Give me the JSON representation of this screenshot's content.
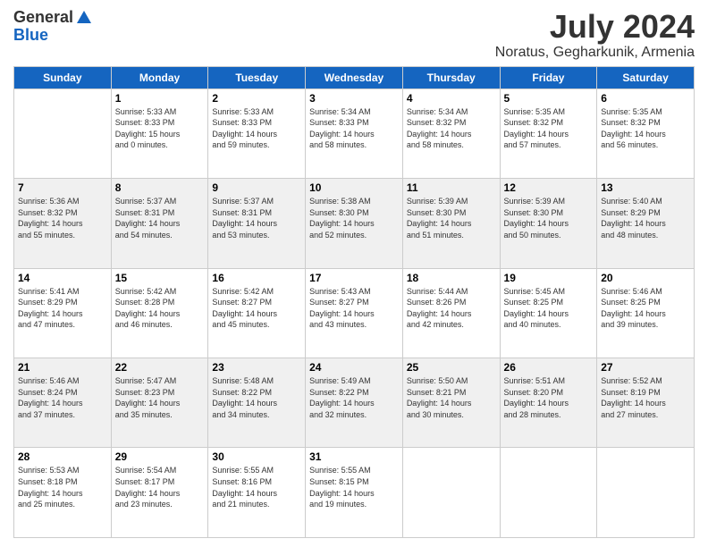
{
  "logo": {
    "general": "General",
    "blue": "Blue"
  },
  "header": {
    "month_year": "July 2024",
    "location": "Noratus, Gegharkunik, Armenia"
  },
  "days_of_week": [
    "Sunday",
    "Monday",
    "Tuesday",
    "Wednesday",
    "Thursday",
    "Friday",
    "Saturday"
  ],
  "weeks": [
    [
      {
        "day": "",
        "info": ""
      },
      {
        "day": "1",
        "info": "Sunrise: 5:33 AM\nSunset: 8:33 PM\nDaylight: 15 hours\nand 0 minutes."
      },
      {
        "day": "2",
        "info": "Sunrise: 5:33 AM\nSunset: 8:33 PM\nDaylight: 14 hours\nand 59 minutes."
      },
      {
        "day": "3",
        "info": "Sunrise: 5:34 AM\nSunset: 8:33 PM\nDaylight: 14 hours\nand 58 minutes."
      },
      {
        "day": "4",
        "info": "Sunrise: 5:34 AM\nSunset: 8:32 PM\nDaylight: 14 hours\nand 58 minutes."
      },
      {
        "day": "5",
        "info": "Sunrise: 5:35 AM\nSunset: 8:32 PM\nDaylight: 14 hours\nand 57 minutes."
      },
      {
        "day": "6",
        "info": "Sunrise: 5:35 AM\nSunset: 8:32 PM\nDaylight: 14 hours\nand 56 minutes."
      }
    ],
    [
      {
        "day": "7",
        "info": "Sunrise: 5:36 AM\nSunset: 8:32 PM\nDaylight: 14 hours\nand 55 minutes."
      },
      {
        "day": "8",
        "info": "Sunrise: 5:37 AM\nSunset: 8:31 PM\nDaylight: 14 hours\nand 54 minutes."
      },
      {
        "day": "9",
        "info": "Sunrise: 5:37 AM\nSunset: 8:31 PM\nDaylight: 14 hours\nand 53 minutes."
      },
      {
        "day": "10",
        "info": "Sunrise: 5:38 AM\nSunset: 8:30 PM\nDaylight: 14 hours\nand 52 minutes."
      },
      {
        "day": "11",
        "info": "Sunrise: 5:39 AM\nSunset: 8:30 PM\nDaylight: 14 hours\nand 51 minutes."
      },
      {
        "day": "12",
        "info": "Sunrise: 5:39 AM\nSunset: 8:30 PM\nDaylight: 14 hours\nand 50 minutes."
      },
      {
        "day": "13",
        "info": "Sunrise: 5:40 AM\nSunset: 8:29 PM\nDaylight: 14 hours\nand 48 minutes."
      }
    ],
    [
      {
        "day": "14",
        "info": "Sunrise: 5:41 AM\nSunset: 8:29 PM\nDaylight: 14 hours\nand 47 minutes."
      },
      {
        "day": "15",
        "info": "Sunrise: 5:42 AM\nSunset: 8:28 PM\nDaylight: 14 hours\nand 46 minutes."
      },
      {
        "day": "16",
        "info": "Sunrise: 5:42 AM\nSunset: 8:27 PM\nDaylight: 14 hours\nand 45 minutes."
      },
      {
        "day": "17",
        "info": "Sunrise: 5:43 AM\nSunset: 8:27 PM\nDaylight: 14 hours\nand 43 minutes."
      },
      {
        "day": "18",
        "info": "Sunrise: 5:44 AM\nSunset: 8:26 PM\nDaylight: 14 hours\nand 42 minutes."
      },
      {
        "day": "19",
        "info": "Sunrise: 5:45 AM\nSunset: 8:25 PM\nDaylight: 14 hours\nand 40 minutes."
      },
      {
        "day": "20",
        "info": "Sunrise: 5:46 AM\nSunset: 8:25 PM\nDaylight: 14 hours\nand 39 minutes."
      }
    ],
    [
      {
        "day": "21",
        "info": "Sunrise: 5:46 AM\nSunset: 8:24 PM\nDaylight: 14 hours\nand 37 minutes."
      },
      {
        "day": "22",
        "info": "Sunrise: 5:47 AM\nSunset: 8:23 PM\nDaylight: 14 hours\nand 35 minutes."
      },
      {
        "day": "23",
        "info": "Sunrise: 5:48 AM\nSunset: 8:22 PM\nDaylight: 14 hours\nand 34 minutes."
      },
      {
        "day": "24",
        "info": "Sunrise: 5:49 AM\nSunset: 8:22 PM\nDaylight: 14 hours\nand 32 minutes."
      },
      {
        "day": "25",
        "info": "Sunrise: 5:50 AM\nSunset: 8:21 PM\nDaylight: 14 hours\nand 30 minutes."
      },
      {
        "day": "26",
        "info": "Sunrise: 5:51 AM\nSunset: 8:20 PM\nDaylight: 14 hours\nand 28 minutes."
      },
      {
        "day": "27",
        "info": "Sunrise: 5:52 AM\nSunset: 8:19 PM\nDaylight: 14 hours\nand 27 minutes."
      }
    ],
    [
      {
        "day": "28",
        "info": "Sunrise: 5:53 AM\nSunset: 8:18 PM\nDaylight: 14 hours\nand 25 minutes."
      },
      {
        "day": "29",
        "info": "Sunrise: 5:54 AM\nSunset: 8:17 PM\nDaylight: 14 hours\nand 23 minutes."
      },
      {
        "day": "30",
        "info": "Sunrise: 5:55 AM\nSunset: 8:16 PM\nDaylight: 14 hours\nand 21 minutes."
      },
      {
        "day": "31",
        "info": "Sunrise: 5:55 AM\nSunset: 8:15 PM\nDaylight: 14 hours\nand 19 minutes."
      },
      {
        "day": "",
        "info": ""
      },
      {
        "day": "",
        "info": ""
      },
      {
        "day": "",
        "info": ""
      }
    ]
  ]
}
